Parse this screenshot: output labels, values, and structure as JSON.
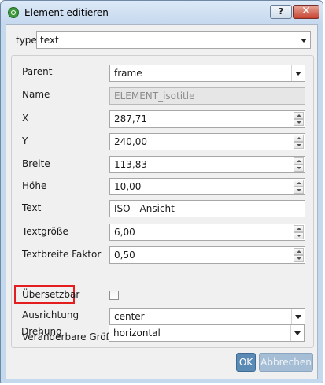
{
  "window": {
    "title": "Element editieren",
    "help_label": "?",
    "close_label": "✕"
  },
  "type_row": {
    "label": "type",
    "value": "text"
  },
  "form": {
    "parent": {
      "label": "Parent",
      "value": "frame"
    },
    "name": {
      "label": "Name",
      "value": "ELEMENT_isotitle"
    },
    "x": {
      "label": "X",
      "value": "287,71"
    },
    "y": {
      "label": "Y",
      "value": "240,00"
    },
    "breite": {
      "label": "Breite",
      "value": "113,83"
    },
    "hoehe": {
      "label": "Höhe",
      "value": "10,00"
    },
    "text": {
      "label": "Text",
      "value": "ISO - Ansicht"
    },
    "textgroesse": {
      "label": "Textgröße",
      "value": "6,00"
    },
    "textbreite_faktor": {
      "label": "Textbreite Faktor",
      "value": "0,50"
    },
    "uebersetzbar": {
      "label": "Übersetzbar",
      "checked": false
    },
    "ausrichtung": {
      "label": "Ausrichtung",
      "value": "center"
    },
    "veraenderbare_groesse": {
      "label": "Veränderbare Größe",
      "checked": false
    },
    "drehung": {
      "label": "Drehung",
      "value": "horizontal"
    }
  },
  "buttons": {
    "ok_label": "OK",
    "cancel_label": "Abbrechen"
  },
  "colors": {
    "highlight": "#e41e1e",
    "ok_button": "#5b8bb5",
    "cancel_button": "#a5bed6"
  }
}
